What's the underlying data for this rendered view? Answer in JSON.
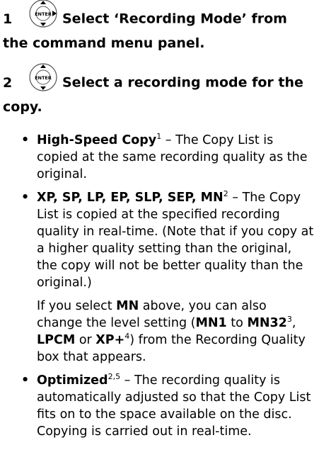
{
  "step1": {
    "number": "1",
    "icon_label": "ENTER",
    "text_line1": "Select ‘Recording Mode’ from",
    "text_line2": "the command menu panel."
  },
  "step2": {
    "number": "2",
    "icon_label": "ENTER",
    "text_line1": "Select a recording mode for the",
    "text_line2": "copy."
  },
  "bullets": [
    {
      "term": "High-Speed Copy",
      "sup": "1",
      "text": " – The Copy List is copied at the same recording quality as the original."
    },
    {
      "term": "XP, SP, LP, EP, SLP, SEP, MN",
      "sup": "2",
      "text": " – The Copy List is copied at the specified recording quality in real-time. (Note that if you copy at a higher quality setting than the original, the copy will not be better quality than the original.)"
    },
    {
      "term": "Optimized",
      "sup": "2,5",
      "text": " – The recording quality is automatically adjusted so that the Copy List fits on to the space available on the disc. Copying is carried out in real-time."
    }
  ],
  "note": {
    "t1": "If you select ",
    "mn": "MN",
    "t2": " above, you can also change the level setting (",
    "mn1": "MN1",
    "t3": " to ",
    "mn32": "MN32",
    "sup3": "3",
    "t4": ", ",
    "lpcm": "LPCM",
    "t5": " or ",
    "xpplus": "XP+",
    "sup4": "4",
    "t6": ") from the Recording Quality box that appears."
  }
}
